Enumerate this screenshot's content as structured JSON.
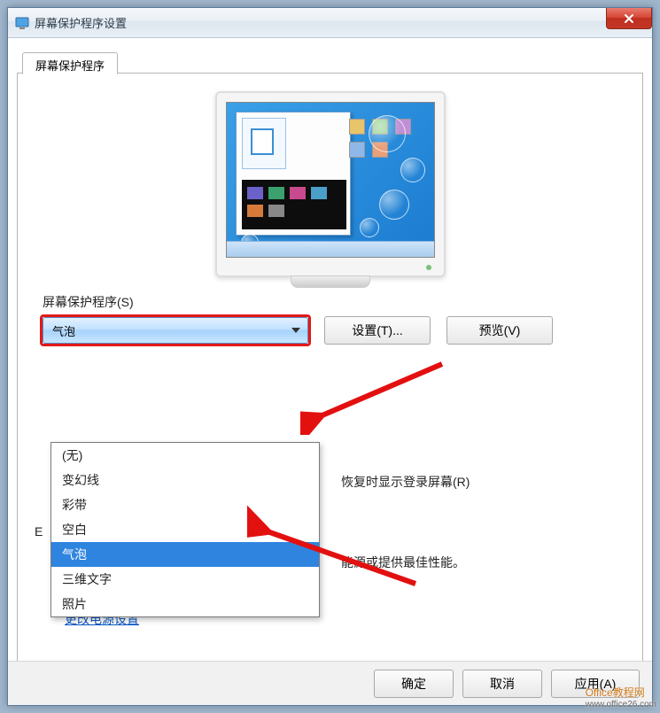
{
  "window": {
    "title": "屏幕保护程序设置"
  },
  "tab": {
    "label": "屏幕保护程序"
  },
  "section": {
    "label": "屏幕保护程序(S)"
  },
  "combo": {
    "selected": "气泡"
  },
  "dropdown": {
    "items": [
      "(无)",
      "变幻线",
      "彩带",
      "空白",
      "气泡",
      "三维文字",
      "照片"
    ],
    "selected_index": 4
  },
  "buttons": {
    "settings": "设置(T)...",
    "preview": "预览(V)",
    "ok": "确定",
    "cancel": "取消",
    "apply": "应用(A)"
  },
  "labels": {
    "resume_partial": "恢复时显示登录屏幕(R)",
    "energy_partial": "能源或提供最佳性能。",
    "letter_e": "E"
  },
  "links": {
    "power": "更改电源设置"
  },
  "watermark": {
    "line1": "Office教程网",
    "line2": "www.office26.com"
  }
}
